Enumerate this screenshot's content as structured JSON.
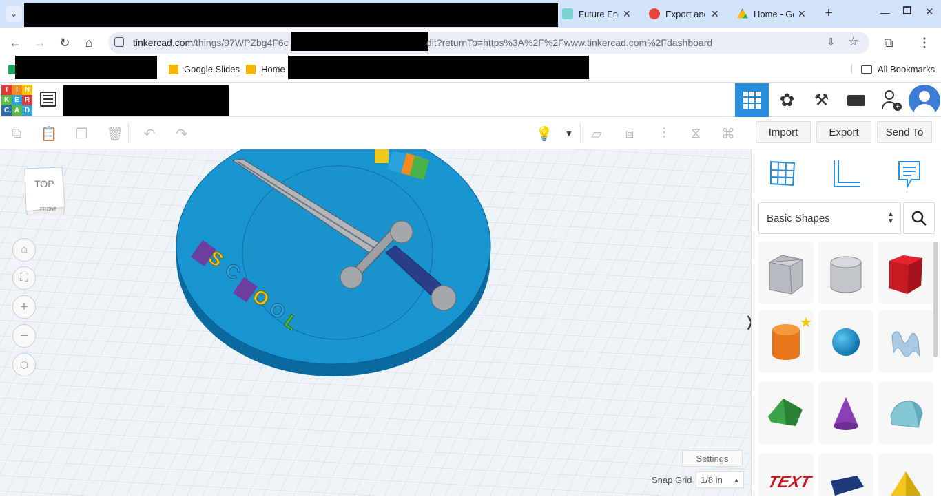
{
  "browser": {
    "tabs": [
      {
        "title": "Future Eng",
        "favicon_color": "#7ad3d3"
      },
      {
        "title": "Export and",
        "favicon_color": "#e8453c"
      },
      {
        "title": "Home - Go",
        "favicon_color": "#1a73e8"
      }
    ],
    "new_tab_label": "+",
    "url": {
      "host": "tinkercad.com",
      "path": "/things/97WPZbg4F6c",
      "query": "dit?returnTo=https%3A%2F%2Fwww.tinkercad.com%2Fdashboard"
    },
    "bookmarks": [
      {
        "label": "Google Slides",
        "icon_color": "#f4b400"
      },
      {
        "label": "Home",
        "icon_color": "#f4b400"
      }
    ],
    "all_bookmarks_label": "All Bookmarks"
  },
  "tinkercad": {
    "logo_letters": [
      "T",
      "I",
      "N",
      "K",
      "E",
      "R",
      "C",
      "A",
      "D"
    ],
    "logo_colors": [
      "#e03a3e",
      "#f58a1f",
      "#f4c300",
      "#5bb946",
      "#2ba3dc",
      "#e03a3e",
      "#2b6cb0",
      "#5bb946",
      "#2ba3dc"
    ],
    "toolbar": {
      "import_label": "Import",
      "export_label": "Export",
      "send_to_label": "Send To"
    },
    "viewcube": {
      "top_label": "TOP",
      "front_label": "FRONT"
    },
    "shapes_panel": {
      "category": "Basic Shapes",
      "shapes": [
        "box",
        "cylinder-hole",
        "box-red",
        "cylinder-orange",
        "sphere",
        "scribble",
        "roof",
        "cone",
        "round-roof",
        "text",
        "wedge",
        "pyramid"
      ]
    },
    "settings_label": "Settings",
    "snap_grid_label": "Snap Grid",
    "snap_grid_value": "1/8 in",
    "model_text_left": "SCHOOL",
    "model_text_top": "IND"
  }
}
